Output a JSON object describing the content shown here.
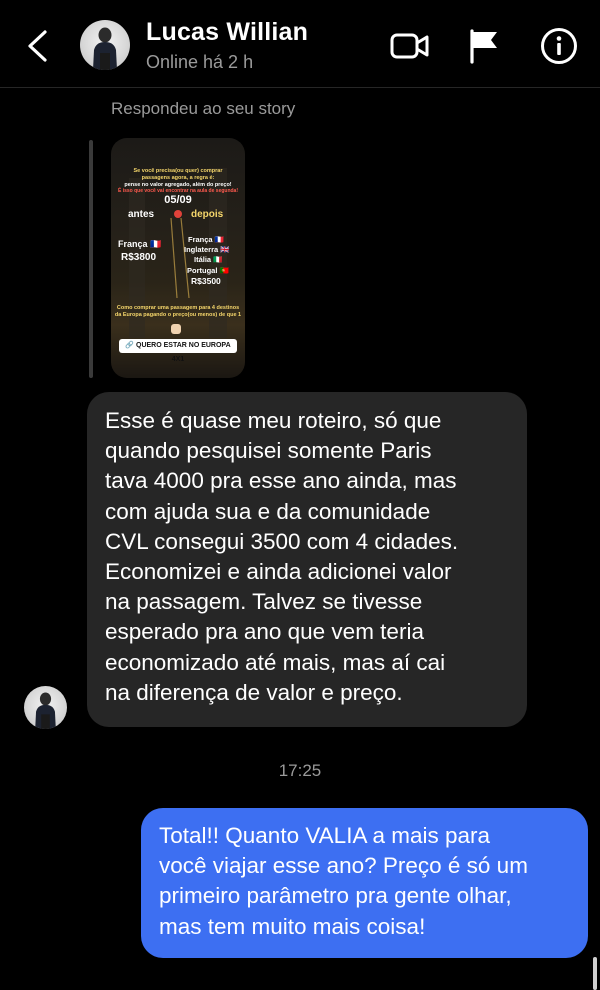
{
  "header": {
    "contact_name": "Lucas Willian",
    "status": "Online há 2 h",
    "back_icon": "chevron-left-icon",
    "actions": [
      "video-call-icon",
      "flag-icon",
      "info-icon"
    ]
  },
  "story_reply": {
    "label": "Respondeu ao seu story",
    "story": {
      "intro": [
        "Se você precisa(ou quer) comprar",
        "passagens agora, a regra é:",
        "pense no valor agregado, além do preço!"
      ],
      "warning": "É isso que você vai encontrar na aula de segunda!",
      "date": "05/09",
      "before_label": "antes",
      "after_label": "depois",
      "before_country": "França 🇫🇷",
      "before_price": "R$3800",
      "after_countries": [
        "França 🇫🇷",
        "Inglaterra 🇬🇧",
        "Itália 🇮🇹",
        "Portugal 🇵🇹"
      ],
      "after_price": "R$3500",
      "footer": [
        "Como comprar uma passagem para 4 destinos",
        "da Europa pagando o preço(ou menos) de que 1"
      ],
      "cta": "🔗 QUERO ESTAR NO EUROPA 4X1"
    }
  },
  "messages": {
    "incoming": {
      "lines": [
        "Esse é quase meu roteiro, só que",
        "quando pesquisei somente Paris",
        "tava 4000 pra esse ano ainda, mas",
        "com ajuda sua e da comunidade",
        "CVL consegui 3500 com 4 cidades.",
        "Economizei e ainda adicionei valor",
        "na passagem. Talvez se tivesse",
        "esperado pra ano que vem teria",
        "economizado até mais, mas aí cai",
        "na diferença de valor e preço."
      ]
    },
    "timestamp": "17:25",
    "outgoing": {
      "lines": [
        "Total!! Quanto VALIA a mais para",
        "você viajar esse ano? Preço é só um",
        "primeiro parâmetro pra gente olhar,",
        "mas tem muito mais coisa!"
      ]
    }
  },
  "colors": {
    "background": "#000000",
    "incoming_bubble": "#262626",
    "outgoing_bubble": "#3d6ff2",
    "muted_text": "#9a9a9a",
    "story_accent": "#f5d66b"
  }
}
